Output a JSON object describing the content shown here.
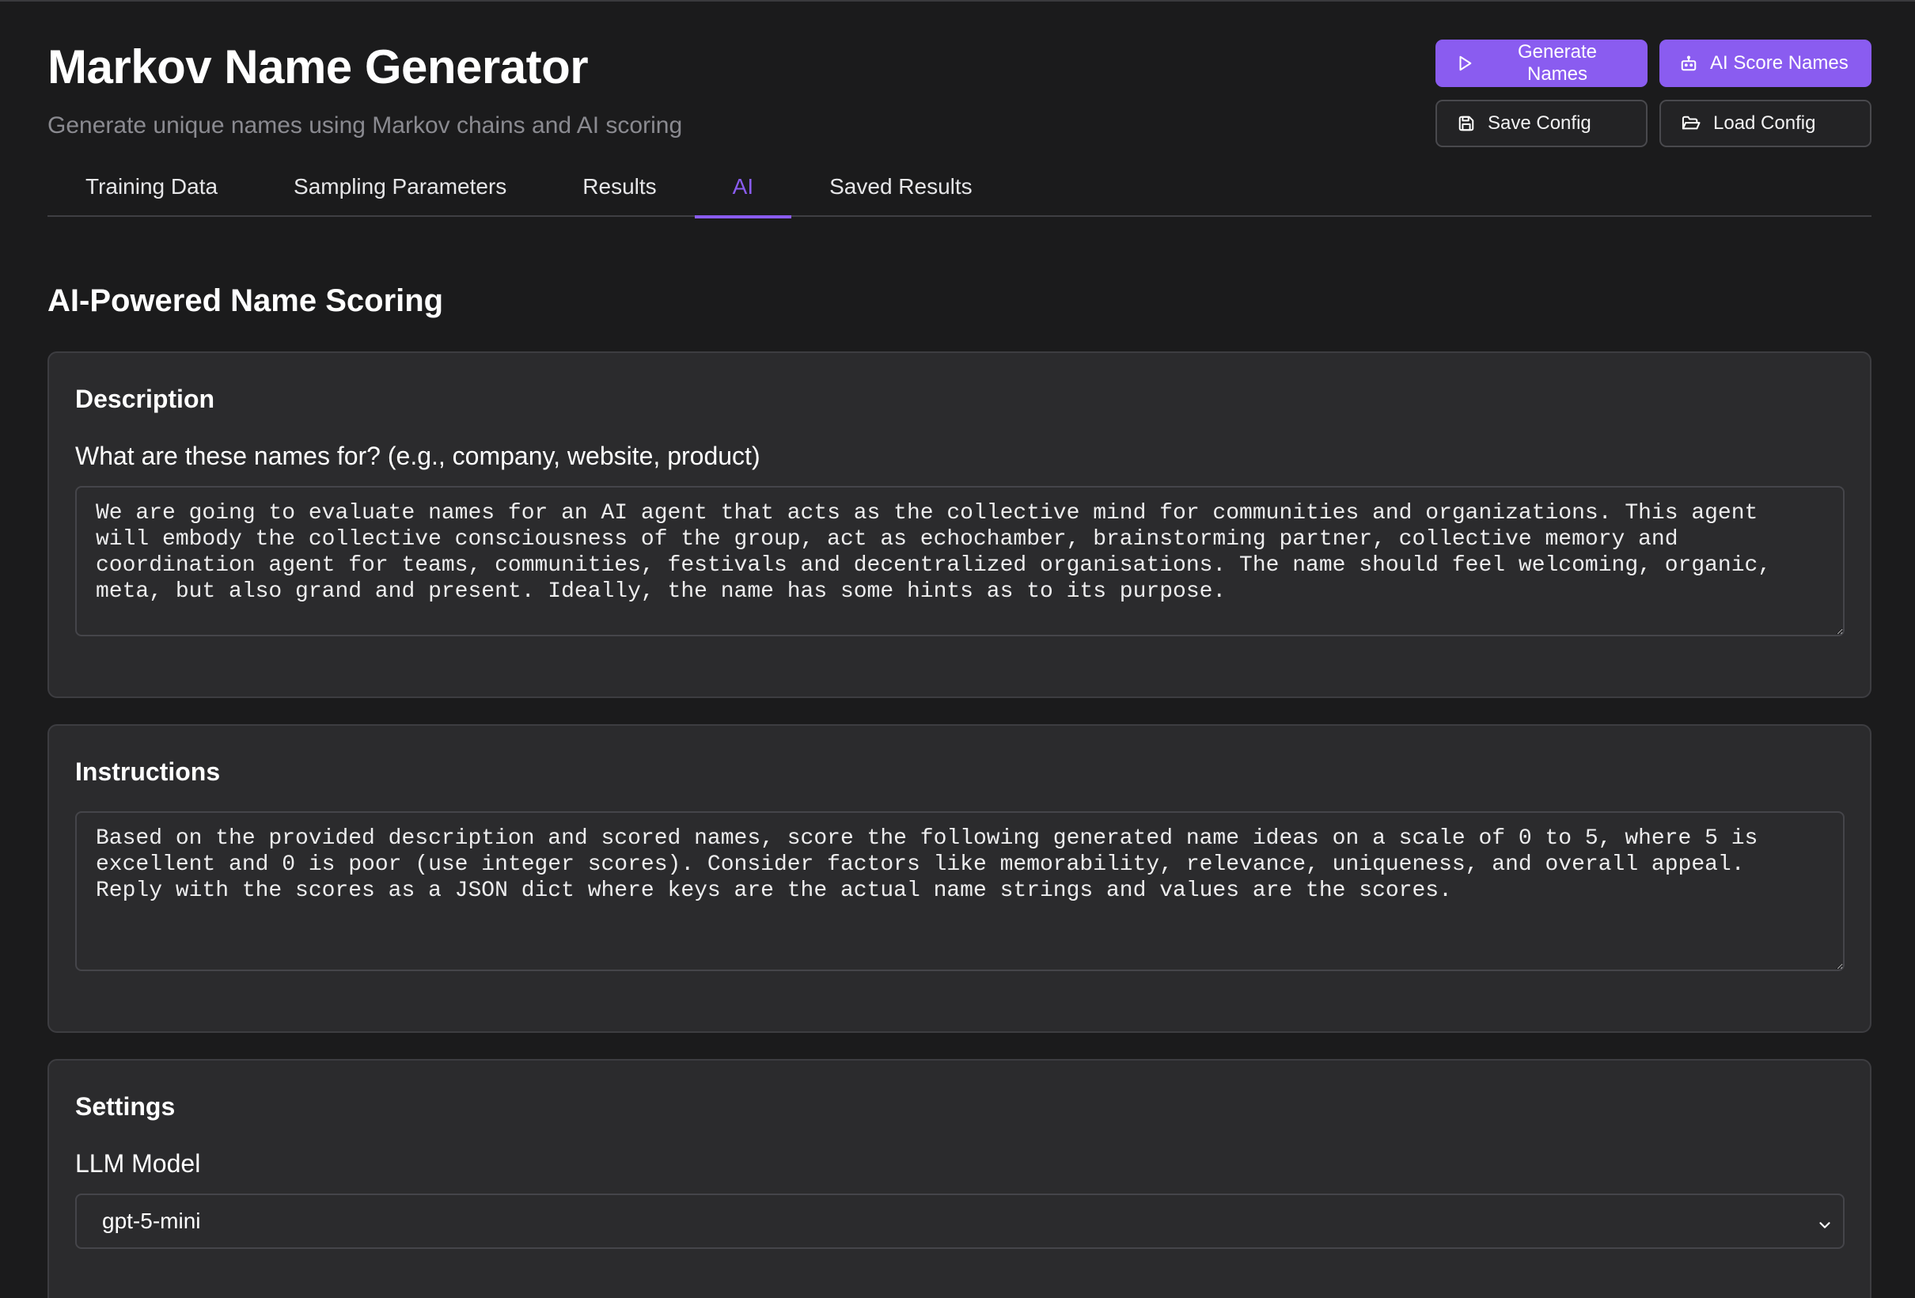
{
  "header": {
    "title": "Markov Name Generator",
    "subtitle": "Generate unique names using Markov chains and AI scoring"
  },
  "actions": {
    "generate_label": "Generate Names",
    "score_label": "AI Score Names",
    "save_label": "Save Config",
    "load_label": "Load Config"
  },
  "tabs": [
    {
      "label": "Training Data",
      "active": false
    },
    {
      "label": "Sampling Parameters",
      "active": false
    },
    {
      "label": "Results",
      "active": false
    },
    {
      "label": "AI",
      "active": true
    },
    {
      "label": "Saved Results",
      "active": false
    }
  ],
  "main": {
    "heading": "AI-Powered Name Scoring",
    "description": {
      "title": "Description",
      "label": "What are these names for? (e.g., company, website, product)",
      "value": "We are going to evaluate names for an AI agent that acts as the collective mind for communities and organizations. This agent will embody the collective consciousness of the group, act as echochamber, brainstorming partner, collective memory and coordination agent for teams, communities, festivals and decentralized organisations. The name should feel welcoming, organic, meta, but also grand and present. Ideally, the name has some hints as to its purpose."
    },
    "instructions": {
      "title": "Instructions",
      "value": "Based on the provided description and scored names, score the following generated name ideas on a scale of 0 to 5, where 5 is excellent and 0 is poor (use integer scores). Consider factors like memorability, relevance, uniqueness, and overall appeal. Reply with the scores as a JSON dict where keys are the actual name strings and values are the scores."
    },
    "settings": {
      "title": "Settings",
      "model_label": "LLM Model",
      "model_value": "gpt-5-mini"
    }
  },
  "colors": {
    "accent": "#8a5cf0",
    "background": "#1b1b1c",
    "card": "#2b2b2d",
    "border": "#3d3d41",
    "muted_text": "#8a8a90"
  },
  "icons": {
    "generate": "play-icon",
    "score": "robot-icon",
    "save": "floppy-disk-icon",
    "load": "folder-open-icon",
    "select": "chevron-down-icon"
  }
}
